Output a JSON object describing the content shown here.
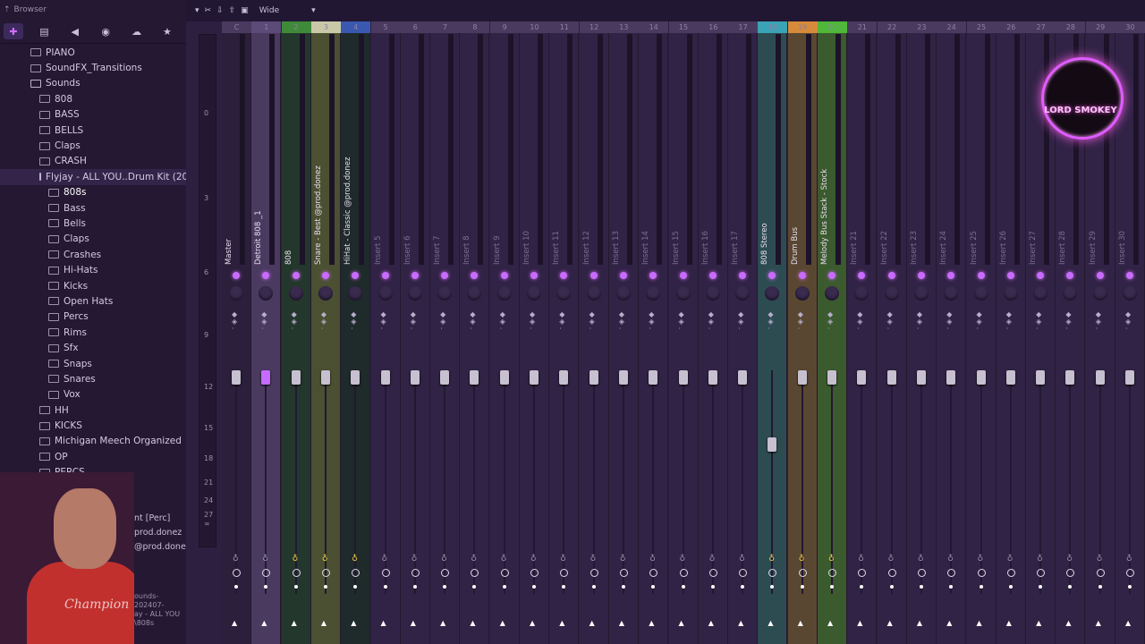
{
  "browser": {
    "header_label": "Browser",
    "tabs": [
      "all-icon",
      "file-icon",
      "speaker-icon",
      "globe-icon",
      "cloud-icon",
      "star-icon"
    ],
    "tree": [
      {
        "label": "PIANO",
        "level": 0
      },
      {
        "label": "SoundFX_Transitions",
        "level": 0
      },
      {
        "label": "Sounds",
        "level": 0,
        "open": true
      },
      {
        "label": "808",
        "level": 1
      },
      {
        "label": "BASS",
        "level": 1
      },
      {
        "label": "BELLS",
        "level": 1
      },
      {
        "label": "Claps",
        "level": 1
      },
      {
        "label": "CRASH",
        "level": 1
      },
      {
        "label": "Flyjay - ALL YOU..Drum Kit (2025)",
        "level": 1,
        "open": true,
        "selected": true
      },
      {
        "label": "808s",
        "level": 2,
        "bold": true
      },
      {
        "label": "Bass",
        "level": 2
      },
      {
        "label": "Bells",
        "level": 2
      },
      {
        "label": "Claps",
        "level": 2
      },
      {
        "label": "Crashes",
        "level": 2
      },
      {
        "label": "Hi-Hats",
        "level": 2
      },
      {
        "label": "Kicks",
        "level": 2
      },
      {
        "label": "Open Hats",
        "level": 2
      },
      {
        "label": "Percs",
        "level": 2
      },
      {
        "label": "Rims",
        "level": 2
      },
      {
        "label": "Sfx",
        "level": 2
      },
      {
        "label": "Snaps",
        "level": 2
      },
      {
        "label": "Snares",
        "level": 2
      },
      {
        "label": "Vox",
        "level": 2
      },
      {
        "label": "HH",
        "level": 1
      },
      {
        "label": "KICKS",
        "level": 1
      },
      {
        "label": "Michigan Meech Organized",
        "level": 1
      },
      {
        "label": "OP",
        "level": 1
      },
      {
        "label": "PERCS",
        "level": 1
      }
    ],
    "overlay_lines": [
      "nt [Perc]",
      "prod.donez",
      "@prod.doner"
    ],
    "overlay_small": [
      "ounds-202407-",
      "ay - ALL YOU",
      "\\808s"
    ],
    "webcam_shirt_text": "Champion"
  },
  "mixer": {
    "toolbar": {
      "mode_label": "Wide"
    },
    "scale": [
      "0",
      "3",
      "6",
      "9",
      "12",
      "15",
      "18",
      "21",
      "24",
      "27",
      "∞"
    ],
    "tracks": [
      {
        "num": "C",
        "name": "Master",
        "kind": "master",
        "fader": 0.5
      },
      {
        "num": "1",
        "name": "Detroit 808 _1",
        "kind": "selected",
        "fader": 0.5
      },
      {
        "num": "2",
        "name": "808",
        "kind": "green",
        "fader": 0.5
      },
      {
        "num": "3",
        "name": "Snare - Best @prod.donez",
        "kind": "olive",
        "fader": 0.5
      },
      {
        "num": "4",
        "name": "HiHat - Classic @prod.donez",
        "kind": "dark",
        "fader": 0.5
      },
      {
        "num": "5",
        "name": "Insert 5",
        "kind": "plain",
        "fader": 0.5
      },
      {
        "num": "6",
        "name": "Insert 6",
        "kind": "plain",
        "fader": 0.5
      },
      {
        "num": "7",
        "name": "Insert 7",
        "kind": "plain",
        "fader": 0.5
      },
      {
        "num": "8",
        "name": "Insert 8",
        "kind": "plain",
        "fader": 0.5
      },
      {
        "num": "9",
        "name": "Insert 9",
        "kind": "plain",
        "fader": 0.5
      },
      {
        "num": "10",
        "name": "Insert 10",
        "kind": "plain",
        "fader": 0.5
      },
      {
        "num": "11",
        "name": "Insert 11",
        "kind": "plain",
        "fader": 0.5
      },
      {
        "num": "12",
        "name": "Insert 12",
        "kind": "plain",
        "fader": 0.5
      },
      {
        "num": "13",
        "name": "Insert 13",
        "kind": "plain",
        "fader": 0.5
      },
      {
        "num": "14",
        "name": "Insert 14",
        "kind": "plain",
        "fader": 0.5
      },
      {
        "num": "15",
        "name": "Insert 15",
        "kind": "plain",
        "fader": 0.5
      },
      {
        "num": "16",
        "name": "Insert 16",
        "kind": "plain",
        "fader": 0.5
      },
      {
        "num": "17",
        "name": "Insert 17",
        "kind": "plain",
        "fader": 0.5
      },
      {
        "num": "18",
        "name": "808 Stereo",
        "kind": "teal",
        "fader": 0.2
      },
      {
        "num": "19",
        "name": "Drum Bus",
        "kind": "orange",
        "fader": 0.5
      },
      {
        "num": "20",
        "name": "Melody Bus Stack - Stock",
        "kind": "lgreen",
        "fader": 0.5
      },
      {
        "num": "21",
        "name": "Insert 21",
        "kind": "plain",
        "fader": 0.5
      },
      {
        "num": "22",
        "name": "Insert 22",
        "kind": "plain",
        "fader": 0.5
      },
      {
        "num": "23",
        "name": "Insert 23",
        "kind": "plain",
        "fader": 0.5
      },
      {
        "num": "24",
        "name": "Insert 24",
        "kind": "plain",
        "fader": 0.5
      },
      {
        "num": "25",
        "name": "Insert 25",
        "kind": "plain",
        "fader": 0.5
      },
      {
        "num": "26",
        "name": "Insert 26",
        "kind": "plain",
        "fader": 0.5
      },
      {
        "num": "27",
        "name": "Insert 27",
        "kind": "plain",
        "fader": 0.5
      },
      {
        "num": "28",
        "name": "Insert 28",
        "kind": "plain",
        "fader": 0.5
      },
      {
        "num": "29",
        "name": "Insert 29",
        "kind": "plain",
        "fader": 0.5
      },
      {
        "num": "30",
        "name": "Insert 30",
        "kind": "plain",
        "fader": 0.5
      }
    ],
    "logo_text": "LORD SMOKEY"
  }
}
